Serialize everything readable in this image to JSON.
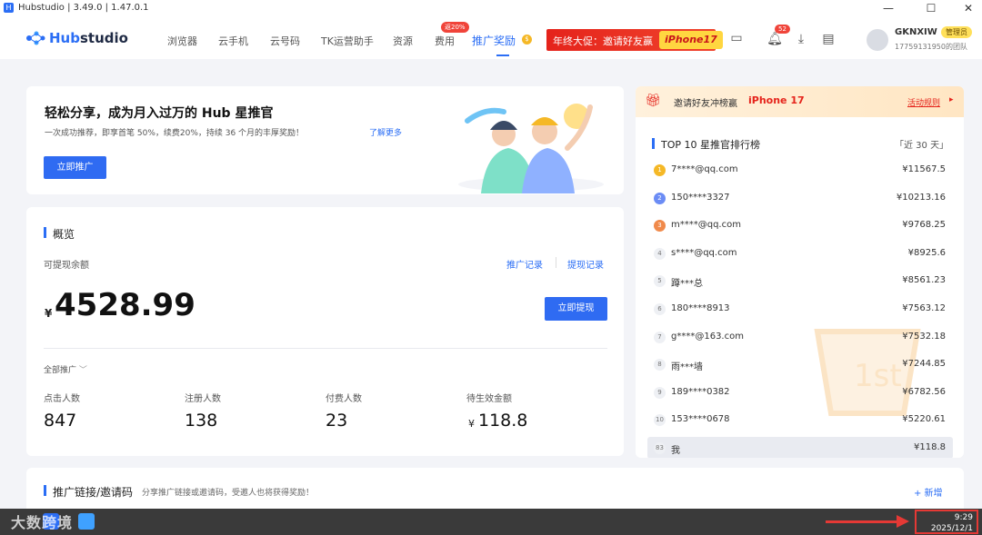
{
  "window": {
    "title": "Hubstudio | 3.49.0 | 1.47.0.1",
    "min": "—",
    "max": "☐",
    "close": "✕"
  },
  "nav": {
    "brand_prefix": "Hub",
    "brand_suffix": "studio",
    "items": [
      "浏览器",
      "云手机",
      "云号码",
      "TK运营助手",
      "资源",
      "费用"
    ],
    "active": "推广奖励",
    "hot_badge": "返20%",
    "promo_text": "年终大促：邀请好友赢",
    "promo_prize": "iPhone17",
    "notif_count": "52",
    "user": "GKNXIW",
    "role": "管理员",
    "team": "17759131950的团队"
  },
  "hero": {
    "title": "轻松分享，成为月入过万的 Hub 星推官",
    "subtitle": "一次成功推荐，即享首笔 50%，续费20%，持续 36 个月的丰厚奖励！",
    "learn_more": "了解更多",
    "cta": "立即推广"
  },
  "overview": {
    "title": "概览",
    "balance_label": "可提现余额",
    "records_link": "推广记录",
    "withdraw_records_link": "提现记录",
    "currency": "¥",
    "balance": "4528.99",
    "withdraw_btn": "立即提现",
    "filter": "全部推广",
    "stats": [
      {
        "label": "点击人数",
        "value": "847"
      },
      {
        "label": "注册人数",
        "value": "138"
      },
      {
        "label": "付费人数",
        "value": "23"
      },
      {
        "label": "待生效金额",
        "value": "118.8",
        "currency": "¥"
      }
    ]
  },
  "ranking": {
    "banner": "邀请好友冲榜赢",
    "banner_prize": "iPhone 17",
    "rules": "活动规则",
    "title": "TOP 10 星推官排行榜",
    "period": "「近 30 天」",
    "rows": [
      {
        "rank": "1",
        "name": "7****@qq.com",
        "amount": "¥11567.5"
      },
      {
        "rank": "2",
        "name": "150****3327",
        "amount": "¥10213.16"
      },
      {
        "rank": "3",
        "name": "m****@qq.com",
        "amount": "¥9768.25"
      },
      {
        "rank": "4",
        "name": "s****@qq.com",
        "amount": "¥8925.6"
      },
      {
        "rank": "5",
        "name": "蹲***总",
        "amount": "¥8561.23"
      },
      {
        "rank": "6",
        "name": "180****8913",
        "amount": "¥7563.12"
      },
      {
        "rank": "7",
        "name": "g****@163.com",
        "amount": "¥7532.18"
      },
      {
        "rank": "8",
        "name": "雨***墙",
        "amount": "¥7244.85"
      },
      {
        "rank": "9",
        "name": "189****0382",
        "amount": "¥6782.56"
      },
      {
        "rank": "10",
        "name": "153****0678",
        "amount": "¥5220.61"
      }
    ],
    "me": {
      "rank": "83",
      "name": "我",
      "amount": "¥118.8"
    }
  },
  "links": {
    "title": "推广链接/邀请码",
    "subtitle": "分享推广链接或邀请码，受邀人也将获得奖励！",
    "add": "+ 新增"
  },
  "taskbar": {
    "time": "9:29",
    "date": "2025/12/1",
    "watermark": "大数跨境"
  },
  "colors": {
    "accent": "#2b6ef5",
    "promo": "#e5231b",
    "highlight": "#e53935"
  }
}
